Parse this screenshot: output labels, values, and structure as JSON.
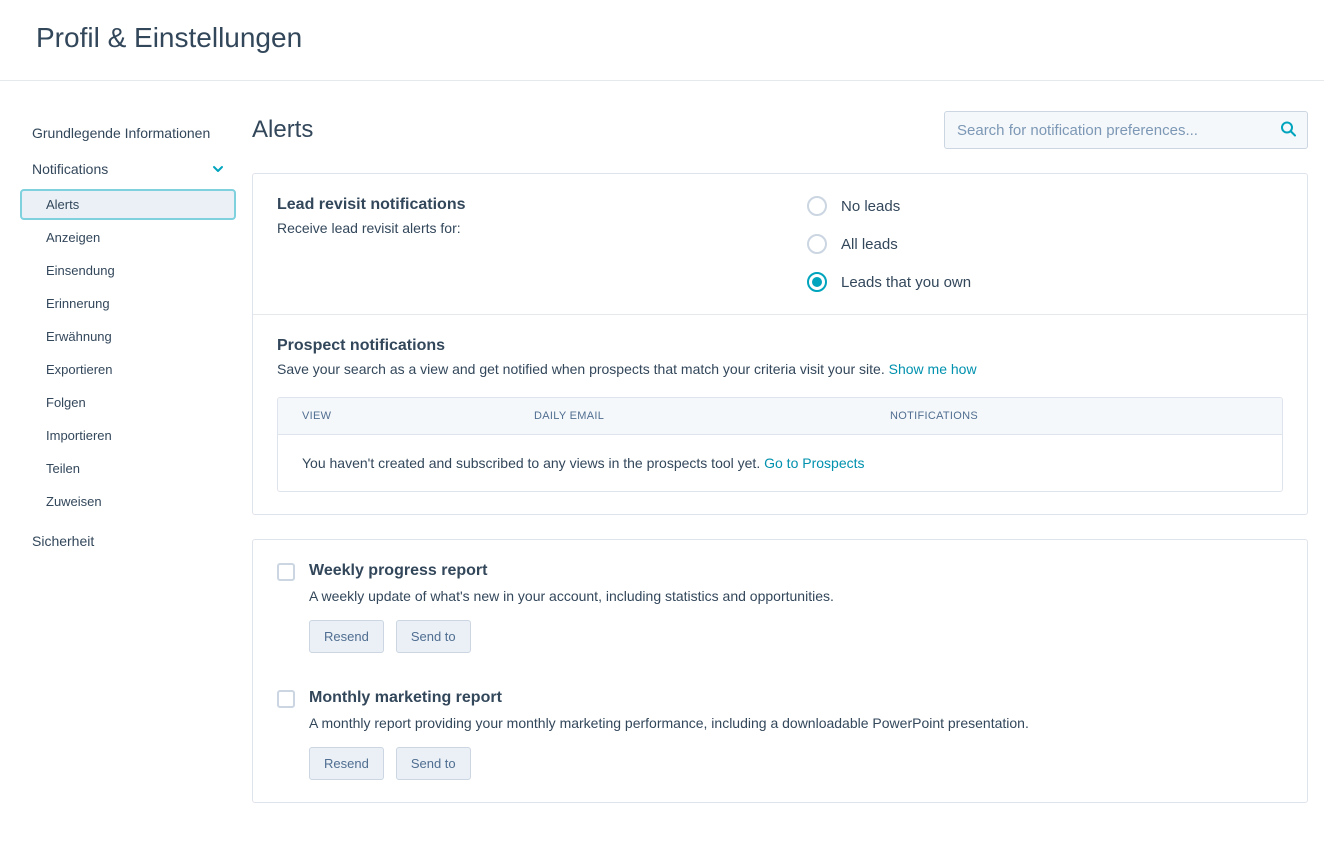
{
  "header": {
    "title": "Profil & Einstellungen"
  },
  "sidebar": {
    "items": [
      {
        "label": "Grundlegende Informationen",
        "expandable": false
      },
      {
        "label": "Notifications",
        "expandable": true,
        "expanded": true,
        "children": [
          {
            "label": "Alerts",
            "active": true
          },
          {
            "label": "Anzeigen"
          },
          {
            "label": "Einsendung"
          },
          {
            "label": "Erinnerung"
          },
          {
            "label": "Erwähnung"
          },
          {
            "label": "Exportieren"
          },
          {
            "label": "Folgen"
          },
          {
            "label": "Importieren"
          },
          {
            "label": "Teilen"
          },
          {
            "label": "Zuweisen"
          }
        ]
      },
      {
        "label": "Sicherheit",
        "expandable": false
      }
    ]
  },
  "main": {
    "title": "Alerts",
    "search_placeholder": "Search for notification preferences..."
  },
  "lead_revisit": {
    "title": "Lead revisit notifications",
    "desc": "Receive lead revisit alerts for:",
    "options": [
      {
        "label": "No leads",
        "selected": false
      },
      {
        "label": "All leads",
        "selected": false
      },
      {
        "label": "Leads that you own",
        "selected": true
      }
    ]
  },
  "prospect": {
    "title": "Prospect notifications",
    "desc": "Save your search as a view and get notified when prospects that match your criteria visit your site. ",
    "show_link": "Show me how",
    "columns": {
      "view": "VIEW",
      "daily": "DAILY EMAIL",
      "notif": "NOTIFICATIONS"
    },
    "empty_text": "You haven't created and subscribed to any views in the prospects tool yet. ",
    "empty_link": "Go to Prospects"
  },
  "reports": [
    {
      "title": "Weekly progress report",
      "desc": "A weekly update of what's new in your account, including statistics and opportunities.",
      "resend": "Resend",
      "send_to": "Send to"
    },
    {
      "title": "Monthly marketing report",
      "desc": "A monthly report providing your monthly marketing performance, including a downloadable PowerPoint presentation.",
      "resend": "Resend",
      "send_to": "Send to"
    }
  ]
}
